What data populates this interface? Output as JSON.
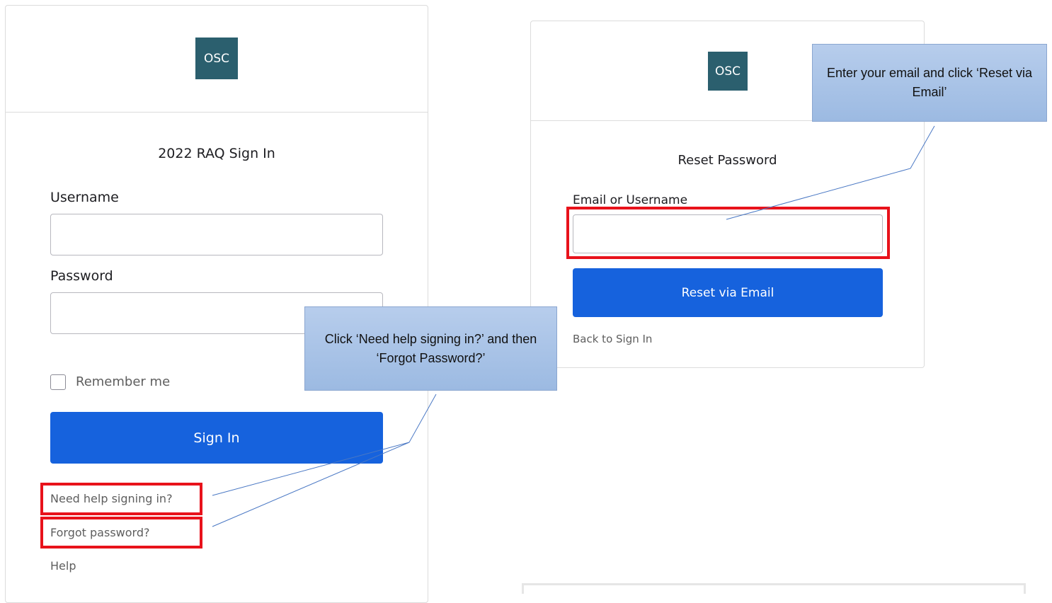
{
  "signin": {
    "logo_text": "OSC",
    "title": "2022 RAQ Sign In",
    "username_label": "Username",
    "username_value": "",
    "password_label": "Password",
    "password_value": "",
    "remember_label": "Remember me",
    "remember_checked": false,
    "signin_button": "Sign In",
    "need_help_link": "Need help signing in?",
    "forgot_link": "Forgot password?",
    "help_link": "Help"
  },
  "reset": {
    "logo_text": "OSC",
    "title": "Reset Password",
    "email_label": "Email or Username",
    "email_value": "",
    "reset_button": "Reset via Email",
    "back_link": "Back to Sign In"
  },
  "callouts": {
    "signin_tip": "Click ‘Need help signing in?’ and then ‘Forgot Password?’",
    "reset_tip": "Enter your email and click ‘Reset via Email’"
  },
  "colors": {
    "brand_logo": "#2b5f6e",
    "primary_button": "#1662dd",
    "highlight": "#e8121b",
    "callout": "#a8c2e8"
  }
}
